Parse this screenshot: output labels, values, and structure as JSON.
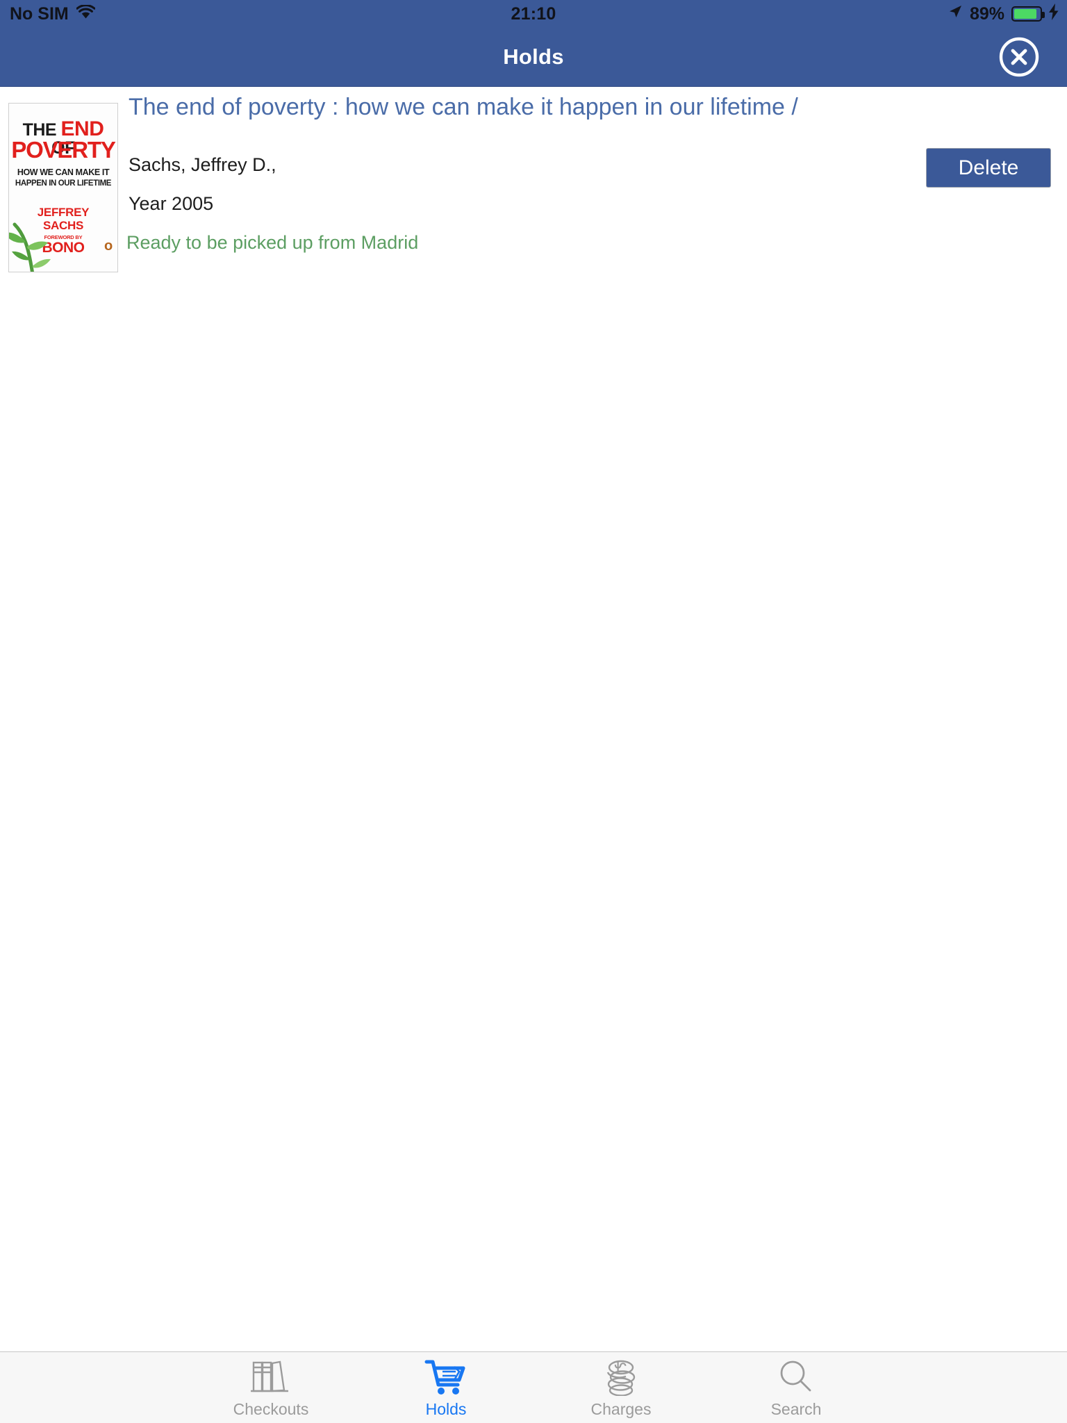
{
  "status_bar": {
    "carrier": "No SIM",
    "wifi_icon": "wifi-icon",
    "time": "21:10",
    "location_icon": "location-arrow-icon",
    "battery_percent": "89%",
    "battery_level": 89,
    "battery_icon": "battery-icon",
    "charging_icon": "lightning-bolt-icon"
  },
  "navbar": {
    "title": "Holds",
    "close_icon": "close-circle-icon",
    "background": "#3b5998"
  },
  "holds": [
    {
      "title": "The end of poverty : how we can make it happen in our lifetime /",
      "author": "Sachs, Jeffrey D.,",
      "year": "Year 2005",
      "status": "Ready to be picked up from Madrid",
      "status_color": "#5c9e62",
      "bullet": "o",
      "delete_label": "Delete",
      "cover": {
        "line1_pre": "THE ",
        "line1_em": "END",
        "line1_post": " OF",
        "line2": "POVERTY",
        "sub1": "HOW WE CAN MAKE IT",
        "sub2": "HAPPEN IN OUR LIFETIME",
        "author1": "JEFFREY",
        "author2": "SACHS",
        "foreword": "FOREWORD BY",
        "bono": "BONO",
        "red": "#e1201d",
        "plant_icon": "seedling-icon"
      }
    }
  ],
  "tabbar": {
    "items": [
      {
        "label": "Checkouts",
        "icon": "books-shelf-icon",
        "active": false
      },
      {
        "label": "Holds",
        "icon": "shopping-cart-icon",
        "active": true
      },
      {
        "label": "Charges",
        "icon": "coin-stack-icon",
        "active": false
      },
      {
        "label": "Search",
        "icon": "search-icon",
        "active": false
      }
    ],
    "active_color": "#1877f2",
    "inactive_color": "#9b9b9b"
  }
}
